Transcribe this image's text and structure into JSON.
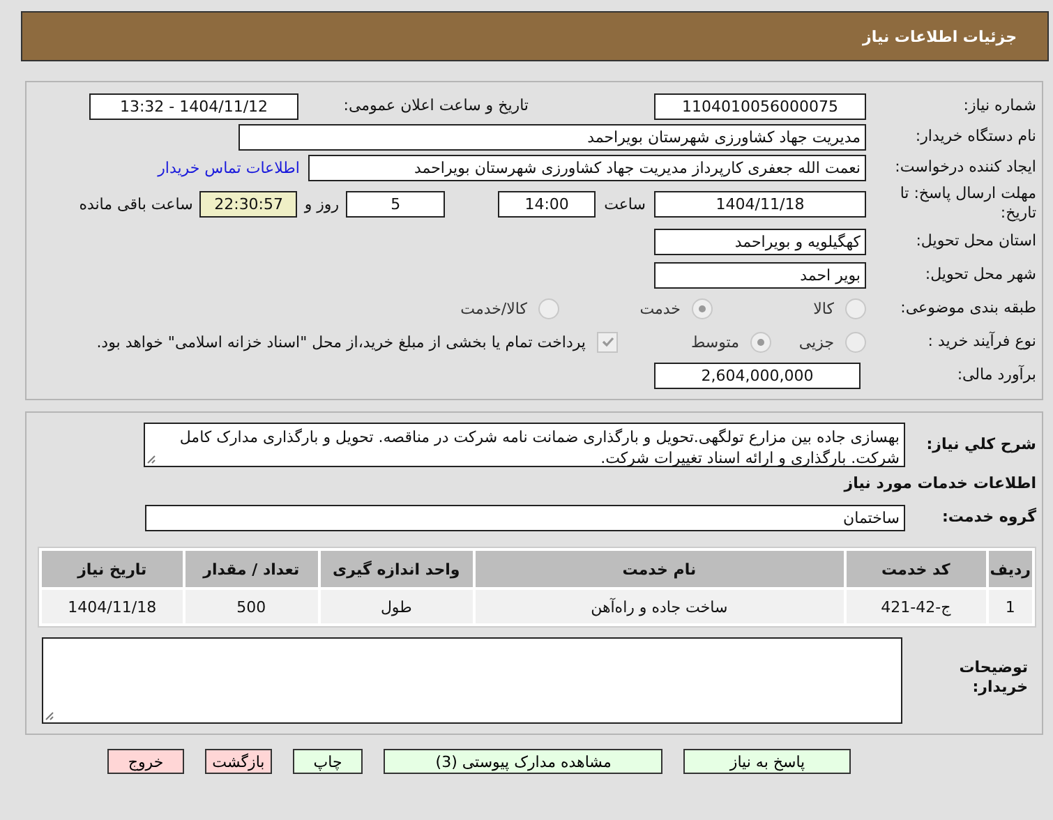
{
  "header": {
    "title": "جزئیات اطلاعات نیاز"
  },
  "need_number": {
    "label": "شماره نیاز:",
    "value": "1104010056000075"
  },
  "announce": {
    "label": "تاریخ و ساعت اعلان عمومی:",
    "value": "1404/11/12 - 13:32"
  },
  "buyer_org": {
    "label": "نام دستگاه خریدار:",
    "value": "مدیریت جهاد کشاورزی شهرستان بویراحمد"
  },
  "requester": {
    "label": "ایجاد کننده درخواست:",
    "value": "نعمت الله جعفری کارپرداز مدیریت جهاد کشاورزی شهرستان بویراحمد",
    "link": "اطلاعات تماس خریدار"
  },
  "deadline": {
    "label": "مهلت ارسال پاسخ: تا تاریخ:",
    "date": "1404/11/18",
    "time_label": "ساعت",
    "time": "14:00",
    "days": "5",
    "days_label": "روز و",
    "remaining": "22:30:57",
    "remaining_label": "ساعت باقی مانده"
  },
  "province": {
    "label": "استان محل تحویل:",
    "value": "کهگیلویه و بویراحمد"
  },
  "city": {
    "label": "شهر محل تحویل:",
    "value": "بویر احمد"
  },
  "category": {
    "label": "طبقه بندی موضوعی:",
    "options": [
      {
        "label": "کالا",
        "selected": false
      },
      {
        "label": "خدمت",
        "selected": true
      },
      {
        "label": "کالا/خدمت",
        "selected": false
      }
    ]
  },
  "process": {
    "label": "نوع فرآیند خرید :",
    "options": [
      {
        "label": "جزیی",
        "selected": false
      },
      {
        "label": "متوسط",
        "selected": true
      }
    ],
    "payment": {
      "checked": true,
      "text": "پرداخت تمام یا بخشی از مبلغ خرید،از محل \"اسناد خزانه اسلامی\" خواهد بود."
    }
  },
  "budget": {
    "label": "برآورد مالی:",
    "value": "2,604,000,000"
  },
  "description": {
    "label": "شرح کلي نياز:",
    "value": "بهسازی جاده بین مزارع تولگهی.تحویل و بارگذاری ضمانت نامه شرکت در مناقصه. تحویل و بارگذاری مدارک کامل شرکت. بارگذاری و ارائه اسناد تغییرات شرکت."
  },
  "services_heading": "اطلاعات خدمات مورد نیاز",
  "service_group": {
    "label": "گروه خدمت:",
    "value": "ساختمان"
  },
  "table": {
    "columns": [
      "ردیف",
      "کد خدمت",
      "نام خدمت",
      "واحد اندازه گیری",
      "تعداد / مقدار",
      "تاریخ نیاز"
    ],
    "rows": [
      [
        "1",
        "ج-42-421",
        "ساخت جاده و راه‌آهن",
        "طول",
        "500",
        "1404/11/18"
      ]
    ]
  },
  "buyer_notes": {
    "label": "توضیحات خریدار:"
  },
  "buttons": [
    {
      "label": "پاسخ به نیاز",
      "kind": "normal"
    },
    {
      "label": "مشاهده مدارک پیوستی (3)",
      "kind": "normal"
    },
    {
      "label": "چاپ",
      "kind": "normal"
    },
    {
      "label": "بازگشت",
      "kind": "danger"
    },
    {
      "label": "خروج",
      "kind": "danger"
    }
  ]
}
